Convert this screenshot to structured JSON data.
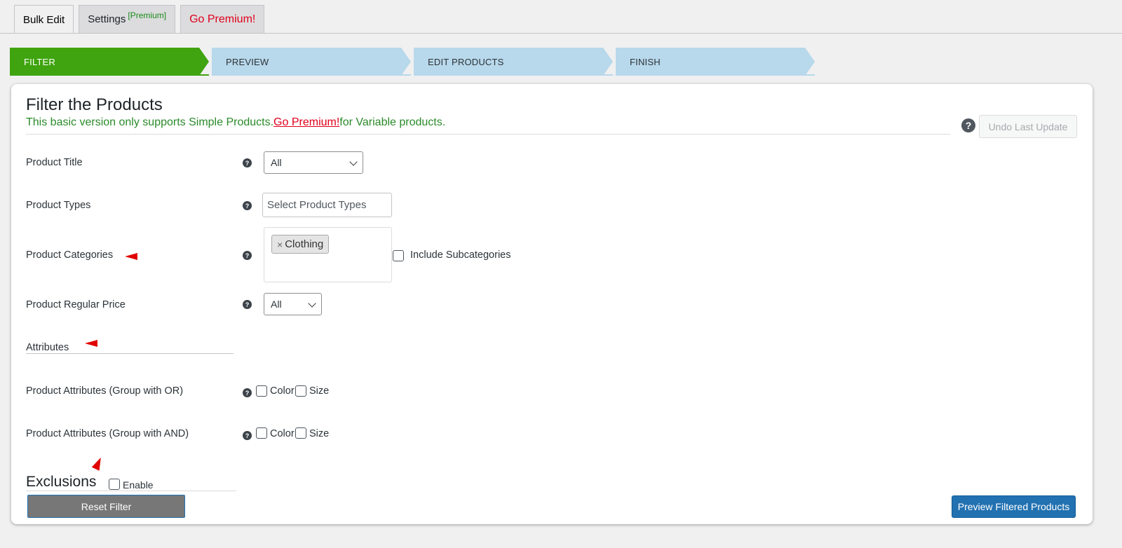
{
  "top_tabs": {
    "bulk_edit": "Bulk Edit",
    "settings": "Settings",
    "settings_badge": "[Premium]",
    "go_premium": "Go Premium!"
  },
  "steps": [
    "FILTER",
    "PREVIEW",
    "EDIT PRODUCTS",
    "FINISH"
  ],
  "card": {
    "title": "Filter the Products",
    "subtitle_before": "This basic version only supports Simple Products.",
    "subtitle_link": "Go Premium!",
    "subtitle_after": "for Variable products.",
    "undo_button": "Undo Last Update",
    "help_glyph": "?"
  },
  "filters": {
    "product_title": {
      "label": "Product Title",
      "value": "All"
    },
    "product_types": {
      "label": "Product Types",
      "placeholder": "Select Product Types"
    },
    "product_categories": {
      "label": "Product Categories",
      "chip": "Clothing",
      "chip_remove": "×",
      "include_sub": "Include Subcategories"
    },
    "product_regular_price": {
      "label": "Product Regular Price",
      "value": "All"
    }
  },
  "attributes": {
    "heading": "Attributes",
    "group_or": {
      "label": "Product Attributes (Group with OR)",
      "opt1": "Color",
      "opt2": "Size"
    },
    "group_and": {
      "label": "Product Attributes (Group with AND)",
      "opt1": "Color",
      "opt2": "Size"
    }
  },
  "exclusions": {
    "heading": "Exclusions",
    "enable": "Enable"
  },
  "actions": {
    "reset": "Reset Filter",
    "preview": "Preview Filtered Products"
  },
  "colors": {
    "active_step": "#3fa40f",
    "inactive_step": "#b8d8eb",
    "primary": "#2271b1",
    "premium_red": "#e0001b",
    "note_green": "#2a8a2a"
  }
}
